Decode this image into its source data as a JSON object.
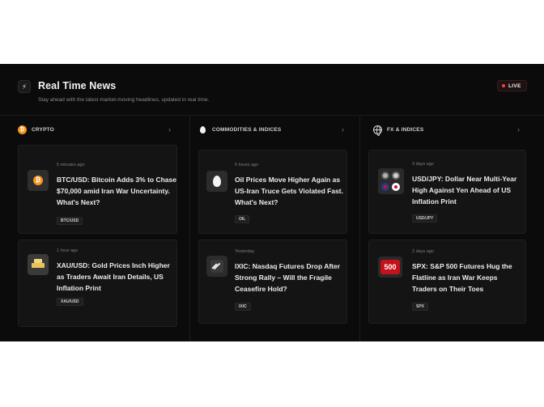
{
  "header": {
    "icon": "lightning-icon",
    "title": "Real Time News",
    "subtitle": "Stay ahead with the latest market-moving headlines, updated in real time.",
    "live_label": "LIVE"
  },
  "columns": [
    {
      "title": "CRYPTO",
      "icon": "bitcoin-icon",
      "cards": [
        {
          "time": "5 minutes ago",
          "headline": "BTC/USD: Bitcoin Adds 3% to Chase $70,000 amid Iran War Uncertainty. What's Next?",
          "tag": "BTC/USD",
          "thumb": "bitcoin-thumb-icon"
        },
        {
          "time": "1 hour ago",
          "headline": "XAU/USD: Gold Prices Inch Higher as Traders Await Iran Details, US Inflation Print",
          "tag": "XAU/USD",
          "thumb": "gold-bars-thumb-icon"
        }
      ]
    },
    {
      "title": "COMMODITIES & INDICES",
      "icon": "oil-drop-icon",
      "cards": [
        {
          "time": "6 hours ago",
          "headline": "Oil Prices Move Higher Again as US-Iran Truce Gets Violated Fast. What's Next?",
          "tag": "OIL",
          "thumb": "oil-drop-thumb-icon"
        },
        {
          "time": "Yesterday",
          "headline": "IXIC: Nasdaq Futures Drop After Strong Rally – Will the Fragile Ceasefire Hold?",
          "tag": "IXIC",
          "thumb": "nasdaq-thumb-icon"
        }
      ]
    },
    {
      "title": "FX & INDICES",
      "icon": "globe-icon",
      "cards": [
        {
          "time": "3 days ago",
          "headline": "USD/JPY: Dollar Near Multi-Year High Against Yen Ahead of US Inflation Print",
          "tag": "USD/JPY",
          "thumb": "usd-jpy-flags-thumb-icon"
        },
        {
          "time": "2 days ago",
          "headline": "SPX: S&P 500 Futures Hug the Flatline as Iran War Keeps Traders on Their Toes",
          "tag": "SPX",
          "thumb": "sp500-thumb-icon",
          "thumb_text": "500"
        }
      ]
    }
  ],
  "colors": {
    "background": "#0b0b0b",
    "card": "#141414",
    "live_dot": "#ff3b3b",
    "bitcoin": "#f7931a",
    "sp500": "#c4111b"
  }
}
